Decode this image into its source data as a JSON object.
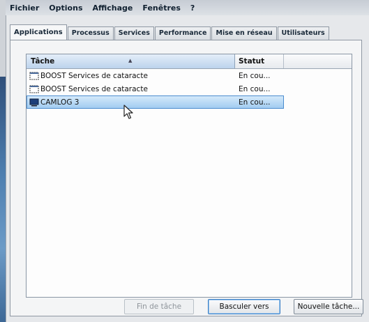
{
  "menubar": {
    "items": [
      "Fichier",
      "Options",
      "Affichage",
      "Fenêtres",
      "?"
    ]
  },
  "tabs": [
    {
      "label": "Applications",
      "active": true
    },
    {
      "label": "Processus",
      "active": false
    },
    {
      "label": "Services",
      "active": false
    },
    {
      "label": "Performance",
      "active": false
    },
    {
      "label": "Mise en réseau",
      "active": false
    },
    {
      "label": "Utilisateurs",
      "active": false
    }
  ],
  "listview": {
    "columns": {
      "task": "Tâche",
      "status": "Statut"
    },
    "rows": [
      {
        "task": "BOOST Services de cataracte",
        "status": "En cou...",
        "icon": "app-window-icon",
        "selected": false
      },
      {
        "task": "BOOST Services de cataracte",
        "status": "En cou...",
        "icon": "app-window-icon",
        "selected": false
      },
      {
        "task": "CAMLOG 3",
        "status": "En cou...",
        "icon": "monitor-app-icon",
        "selected": true
      }
    ]
  },
  "buttons": {
    "end_task": "Fin de tâche",
    "switch_to": "Basculer vers",
    "new_task": "Nouvelle tâche..."
  },
  "colors": {
    "selection": "#9fcaf0",
    "accent": "#3c7fc4"
  }
}
